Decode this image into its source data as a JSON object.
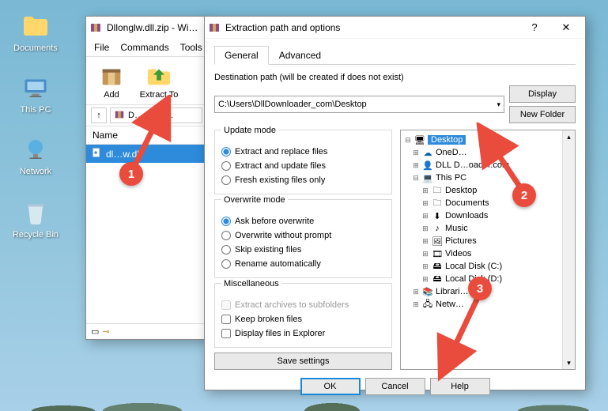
{
  "desktop": {
    "documents": "Documents",
    "thispc": "This PC",
    "network": "Network",
    "recycle": "Recycle Bin"
  },
  "winrar": {
    "title": "Dllonglw.dll.zip - Wi…",
    "menu": {
      "file": "File",
      "commands": "Commands",
      "tools": "Tools"
    },
    "tools": {
      "add": "Add",
      "extract": "Extract To"
    },
    "path_label": "D…glw.dl…",
    "list_header": "Name",
    "file": "dl…w.dll"
  },
  "extract": {
    "title": "Extraction path and options",
    "tabs": {
      "general": "General",
      "advanced": "Advanced"
    },
    "dest_label": "Destination path (will be created if does not exist)",
    "dest_value": "C:\\Users\\DllDownloader_com\\Desktop",
    "display_btn": "Display",
    "newfolder_btn": "New Folder",
    "update": {
      "legend": "Update mode",
      "replace": "Extract and replace files",
      "update": "Extract and update files",
      "fresh": "Fresh existing files only"
    },
    "overwrite": {
      "legend": "Overwrite mode",
      "ask": "Ask before overwrite",
      "noprompt": "Overwrite without prompt",
      "skip": "Skip existing files",
      "rename": "Rename automatically"
    },
    "misc": {
      "legend": "Miscellaneous",
      "subfolders": "Extract archives to subfolders",
      "broken": "Keep broken files",
      "explorer": "Display files in Explorer"
    },
    "save_settings": "Save settings",
    "tree": {
      "desktop": "Desktop",
      "onedrive": "OneD…",
      "dlldown": "DLL D…oader.com",
      "thispc": "This PC",
      "t_desktop": "Desktop",
      "t_documents": "Documents",
      "t_downloads": "Downloads",
      "t_music": "Music",
      "t_pictures": "Pictures",
      "t_videos": "Videos",
      "t_localc": "Local Disk (C:)",
      "t_locald": "Local Disk (D:)",
      "libraries": "Librari…",
      "network": "Netw…"
    },
    "buttons": {
      "ok": "OK",
      "cancel": "Cancel",
      "help": "Help"
    }
  },
  "anno": {
    "one": "1",
    "two": "2",
    "three": "3"
  }
}
